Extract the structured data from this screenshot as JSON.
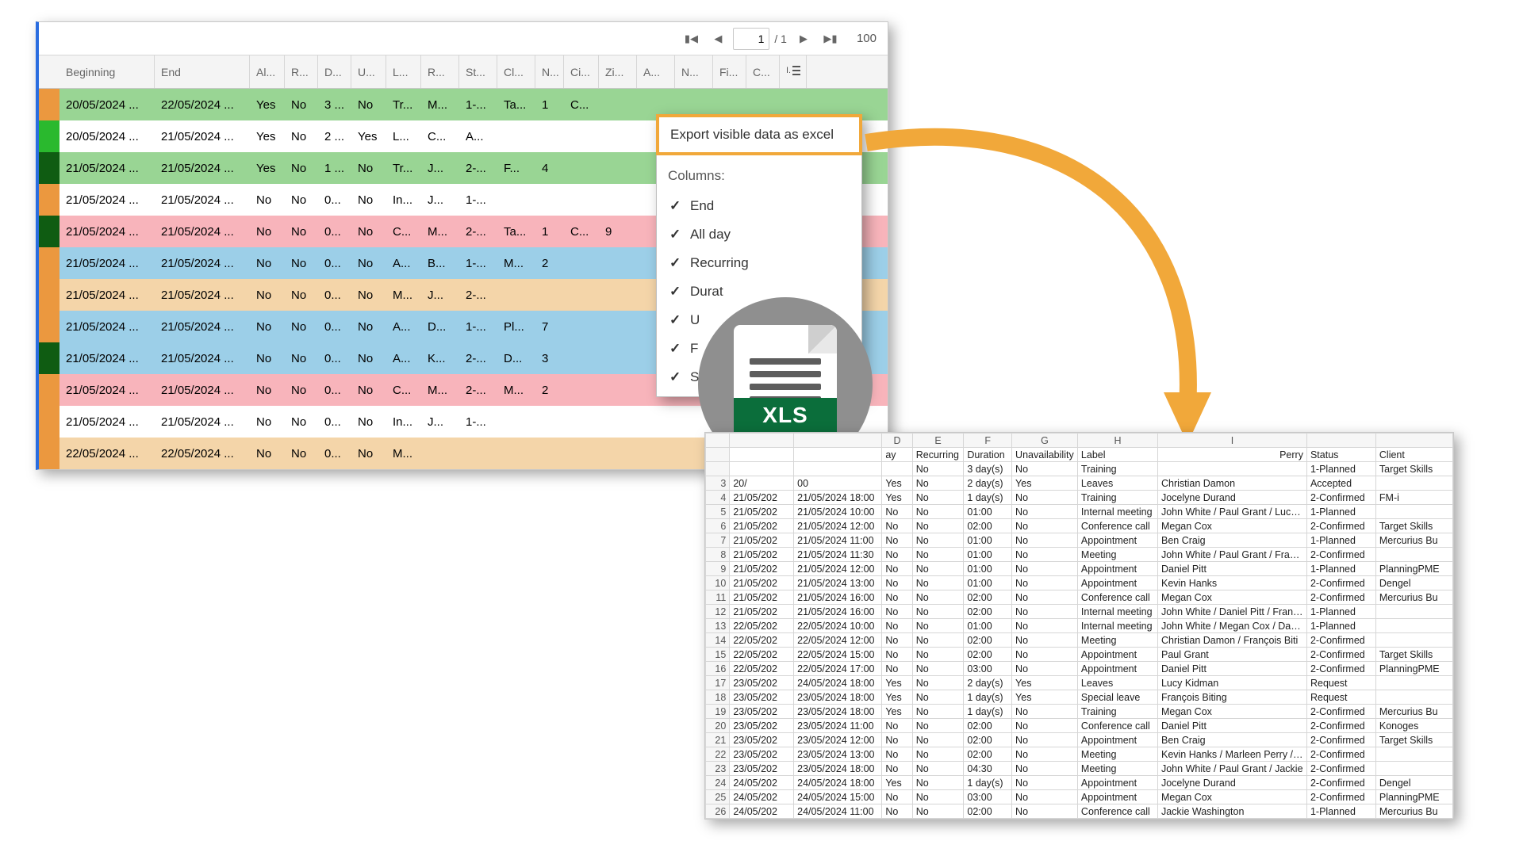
{
  "pager": {
    "page": "1",
    "total_sep": "/ 1",
    "pagesize": "100"
  },
  "columns": [
    "",
    "Beginning",
    "End",
    "Al...",
    "R...",
    "D...",
    "U...",
    "L...",
    "R...",
    "St...",
    "Cl...",
    "N...",
    "Ci...",
    "Zi...",
    "A...",
    "N...",
    "Fi...",
    "C...",
    ""
  ],
  "rows": [
    {
      "side": "side-or",
      "color": "c-green",
      "cells": [
        "20/05/2024 ...",
        "22/05/2024 ...",
        "Yes",
        "No",
        "3 ...",
        "No",
        "Tr...",
        "M...",
        "1-...",
        "Ta...",
        "1",
        "C...",
        "",
        "",
        "",
        "",
        ""
      ]
    },
    {
      "side": "side-gr",
      "color": "c-white",
      "cells": [
        "20/05/2024 ...",
        "21/05/2024 ...",
        "Yes",
        "No",
        "2 ...",
        "Yes",
        "L...",
        "C...",
        "A...",
        "",
        "",
        "",
        "",
        "",
        "",
        "",
        ""
      ]
    },
    {
      "side": "side-dg",
      "color": "c-green",
      "cells": [
        "21/05/2024 ...",
        "21/05/2024 ...",
        "Yes",
        "No",
        "1 ...",
        "No",
        "Tr...",
        "J...",
        "2-...",
        "F...",
        "4",
        "",
        "",
        "",
        "",
        "",
        ""
      ]
    },
    {
      "side": "side-or",
      "color": "c-white",
      "cells": [
        "21/05/2024 ...",
        "21/05/2024 ...",
        "No",
        "No",
        "0...",
        "No",
        "In...",
        "J...",
        "1-...",
        "",
        "",
        "",
        "",
        "",
        "",
        "",
        ""
      ]
    },
    {
      "side": "side-dg",
      "color": "c-pink",
      "cells": [
        "21/05/2024 ...",
        "21/05/2024 ...",
        "No",
        "No",
        "0...",
        "No",
        "C...",
        "M...",
        "2-...",
        "Ta...",
        "1",
        "C...",
        "9",
        "",
        "",
        "",
        ""
      ]
    },
    {
      "side": "side-or",
      "color": "c-blue",
      "cells": [
        "21/05/2024 ...",
        "21/05/2024 ...",
        "No",
        "No",
        "0...",
        "No",
        "A...",
        "B...",
        "1-...",
        "M...",
        "2",
        "",
        "",
        "",
        "",
        "",
        ""
      ]
    },
    {
      "side": "side-or",
      "color": "c-beige",
      "cells": [
        "21/05/2024 ...",
        "21/05/2024 ...",
        "No",
        "No",
        "0...",
        "No",
        "M...",
        "J...",
        "2-...",
        "",
        "",
        "",
        "",
        "",
        "",
        "",
        ""
      ]
    },
    {
      "side": "side-or",
      "color": "c-blue",
      "cells": [
        "21/05/2024 ...",
        "21/05/2024 ...",
        "No",
        "No",
        "0...",
        "No",
        "A...",
        "D...",
        "1-...",
        "Pl...",
        "7",
        "",
        "",
        "",
        "",
        "",
        ""
      ]
    },
    {
      "side": "side-dg",
      "color": "c-blue",
      "cells": [
        "21/05/2024 ...",
        "21/05/2024 ...",
        "No",
        "No",
        "0...",
        "No",
        "A...",
        "K...",
        "2-...",
        "D...",
        "3",
        "",
        "",
        "",
        "",
        "",
        ""
      ]
    },
    {
      "side": "side-or",
      "color": "c-pink",
      "cells": [
        "21/05/2024 ...",
        "21/05/2024 ...",
        "No",
        "No",
        "0...",
        "No",
        "C...",
        "M...",
        "2-...",
        "M...",
        "2",
        "",
        "",
        "",
        "",
        "",
        ""
      ]
    },
    {
      "side": "side-or",
      "color": "c-white",
      "cells": [
        "21/05/2024 ...",
        "21/05/2024 ...",
        "No",
        "No",
        "0...",
        "No",
        "In...",
        "J...",
        "1-...",
        "",
        "",
        "",
        "",
        "",
        "",
        "",
        ""
      ]
    },
    {
      "side": "side-or",
      "color": "c-beige",
      "cells": [
        "22/05/2024 ...",
        "22/05/2024 ...",
        "No",
        "No",
        "0...",
        "No",
        "M...",
        "",
        "",
        "",
        "",
        "",
        "",
        "",
        "",
        "",
        ""
      ]
    }
  ],
  "context": {
    "export": "Export visible data as excel",
    "columns_label": "Columns:",
    "items": [
      "End",
      "All day",
      "Recurring",
      "Durat",
      "U",
      "F",
      "Sta"
    ]
  },
  "xls": {
    "label": "XLS"
  },
  "sheet": {
    "colLetters": [
      "",
      "",
      "",
      "D",
      "E",
      "F",
      "G",
      "H",
      "I"
    ],
    "headers": [
      "",
      "",
      "ay",
      "Recurring",
      "Duration",
      "Unavailability",
      "Label",
      "",
      "Status",
      "Client"
    ],
    "headerPerson": "Perry",
    "rows": [
      {
        "n": "",
        "beg": "",
        "end": "",
        "ad": "",
        "rec": "No",
        "dur": "3 day(s)",
        "una": "No",
        "lab": "Training",
        "per": "",
        "sta": "1-Planned",
        "cli": "Target Skills"
      },
      {
        "n": "3",
        "beg": "20/",
        "end": "00",
        "ad": "Yes",
        "rec": "No",
        "dur": "2 day(s)",
        "una": "Yes",
        "lab": "Leaves",
        "per": "Christian Damon",
        "sta": "Accepted",
        "cli": ""
      },
      {
        "n": "4",
        "beg": "21/05/202",
        "end": "21/05/2024 18:00",
        "ad": "Yes",
        "rec": "No",
        "dur": "1 day(s)",
        "una": "No",
        "lab": "Training",
        "per": "Jocelyne Durand",
        "sta": "2-Confirmed",
        "cli": "FM-i"
      },
      {
        "n": "5",
        "beg": "21/05/202",
        "end": "21/05/2024 10:00",
        "ad": "No",
        "rec": "No",
        "dur": "01:00",
        "una": "No",
        "lab": "Internal meeting",
        "per": "John White / Paul Grant / Lucy Ki",
        "sta": "1-Planned",
        "cli": ""
      },
      {
        "n": "6",
        "beg": "21/05/202",
        "end": "21/05/2024 12:00",
        "ad": "No",
        "rec": "No",
        "dur": "02:00",
        "una": "No",
        "lab": "Conference call",
        "per": "Megan Cox",
        "sta": "2-Confirmed",
        "cli": "Target Skills"
      },
      {
        "n": "7",
        "beg": "21/05/202",
        "end": "21/05/2024 11:00",
        "ad": "No",
        "rec": "No",
        "dur": "01:00",
        "una": "No",
        "lab": "Appointment",
        "per": "Ben Craig",
        "sta": "1-Planned",
        "cli": "Mercurius Bu"
      },
      {
        "n": "8",
        "beg": "21/05/202",
        "end": "21/05/2024 11:30",
        "ad": "No",
        "rec": "No",
        "dur": "01:00",
        "una": "No",
        "lab": "Meeting",
        "per": "John White / Paul Grant / Franço",
        "sta": "2-Confirmed",
        "cli": ""
      },
      {
        "n": "9",
        "beg": "21/05/202",
        "end": "21/05/2024 12:00",
        "ad": "No",
        "rec": "No",
        "dur": "01:00",
        "una": "No",
        "lab": "Appointment",
        "per": "Daniel Pitt",
        "sta": "1-Planned",
        "cli": "PlanningPME"
      },
      {
        "n": "10",
        "beg": "21/05/202",
        "end": "21/05/2024 13:00",
        "ad": "No",
        "rec": "No",
        "dur": "01:00",
        "una": "No",
        "lab": "Appointment",
        "per": "Kevin Hanks",
        "sta": "2-Confirmed",
        "cli": "Dengel"
      },
      {
        "n": "11",
        "beg": "21/05/202",
        "end": "21/05/2024 16:00",
        "ad": "No",
        "rec": "No",
        "dur": "02:00",
        "una": "No",
        "lab": "Conference call",
        "per": "Megan Cox",
        "sta": "2-Confirmed",
        "cli": "Mercurius Bu"
      },
      {
        "n": "12",
        "beg": "21/05/202",
        "end": "21/05/2024 16:00",
        "ad": "No",
        "rec": "No",
        "dur": "02:00",
        "una": "No",
        "lab": "Internal meeting",
        "per": "John White / Daniel Pitt / Franço",
        "sta": "1-Planned",
        "cli": ""
      },
      {
        "n": "13",
        "beg": "22/05/202",
        "end": "22/05/2024 10:00",
        "ad": "No",
        "rec": "No",
        "dur": "01:00",
        "una": "No",
        "lab": "Internal meeting",
        "per": "John White / Megan Cox / Daniel",
        "sta": "1-Planned",
        "cli": ""
      },
      {
        "n": "14",
        "beg": "22/05/202",
        "end": "22/05/2024 12:00",
        "ad": "No",
        "rec": "No",
        "dur": "02:00",
        "una": "No",
        "lab": "Meeting",
        "per": "Christian Damon / François Biti",
        "sta": "2-Confirmed",
        "cli": ""
      },
      {
        "n": "15",
        "beg": "22/05/202",
        "end": "22/05/2024 15:00",
        "ad": "No",
        "rec": "No",
        "dur": "02:00",
        "una": "No",
        "lab": "Appointment",
        "per": "Paul Grant",
        "sta": "2-Confirmed",
        "cli": "Target Skills"
      },
      {
        "n": "16",
        "beg": "22/05/202",
        "end": "22/05/2024 17:00",
        "ad": "No",
        "rec": "No",
        "dur": "03:00",
        "una": "No",
        "lab": "Appointment",
        "per": "Daniel Pitt",
        "sta": "2-Confirmed",
        "cli": "PlanningPME"
      },
      {
        "n": "17",
        "beg": "23/05/202",
        "end": "24/05/2024 18:00",
        "ad": "Yes",
        "rec": "No",
        "dur": "2 day(s)",
        "una": "Yes",
        "lab": "Leaves",
        "per": "Lucy Kidman",
        "sta": "Request",
        "cli": ""
      },
      {
        "n": "18",
        "beg": "23/05/202",
        "end": "23/05/2024 18:00",
        "ad": "Yes",
        "rec": "No",
        "dur": "1 day(s)",
        "una": "Yes",
        "lab": "Special leave",
        "per": "François Biting",
        "sta": "Request",
        "cli": ""
      },
      {
        "n": "19",
        "beg": "23/05/202",
        "end": "23/05/2024 18:00",
        "ad": "Yes",
        "rec": "No",
        "dur": "1 day(s)",
        "una": "No",
        "lab": "Training",
        "per": "Megan Cox",
        "sta": "2-Confirmed",
        "cli": "Mercurius Bu"
      },
      {
        "n": "20",
        "beg": "23/05/202",
        "end": "23/05/2024 11:00",
        "ad": "No",
        "rec": "No",
        "dur": "02:00",
        "una": "No",
        "lab": "Conference call",
        "per": "Daniel Pitt",
        "sta": "2-Confirmed",
        "cli": "Konoges"
      },
      {
        "n": "21",
        "beg": "23/05/202",
        "end": "23/05/2024 12:00",
        "ad": "No",
        "rec": "No",
        "dur": "02:00",
        "una": "No",
        "lab": "Appointment",
        "per": "Ben Craig",
        "sta": "2-Confirmed",
        "cli": "Target Skills"
      },
      {
        "n": "22",
        "beg": "23/05/202",
        "end": "23/05/2024 13:00",
        "ad": "No",
        "rec": "No",
        "dur": "02:00",
        "una": "No",
        "lab": "Meeting",
        "per": "Kevin Hanks / Marleen Perry / Ma",
        "sta": "2-Confirmed",
        "cli": ""
      },
      {
        "n": "23",
        "beg": "23/05/202",
        "end": "23/05/2024 18:00",
        "ad": "No",
        "rec": "No",
        "dur": "04:30",
        "una": "No",
        "lab": "Meeting",
        "per": "John White / Paul Grant / Jackie",
        "sta": "2-Confirmed",
        "cli": ""
      },
      {
        "n": "24",
        "beg": "24/05/202",
        "end": "24/05/2024 18:00",
        "ad": "Yes",
        "rec": "No",
        "dur": "1 day(s)",
        "una": "No",
        "lab": "Appointment",
        "per": "Jocelyne Durand",
        "sta": "2-Confirmed",
        "cli": "Dengel"
      },
      {
        "n": "25",
        "beg": "24/05/202",
        "end": "24/05/2024 15:00",
        "ad": "No",
        "rec": "No",
        "dur": "03:00",
        "una": "No",
        "lab": "Appointment",
        "per": "Megan Cox",
        "sta": "2-Confirmed",
        "cli": "PlanningPME"
      },
      {
        "n": "26",
        "beg": "24/05/202",
        "end": "24/05/2024 11:00",
        "ad": "No",
        "rec": "No",
        "dur": "02:00",
        "una": "No",
        "lab": "Conference call",
        "per": "Jackie Washington",
        "sta": "1-Planned",
        "cli": "Mercurius Bu"
      }
    ]
  }
}
